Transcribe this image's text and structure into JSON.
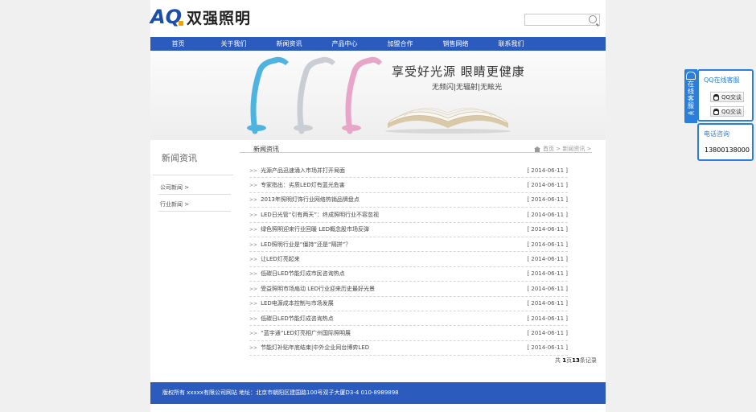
{
  "header": {
    "logo_mark_a": "A",
    "logo_mark_q": "Q",
    "logo_text": "双强照明",
    "search_placeholder": ""
  },
  "nav": [
    "首页",
    "关于我们",
    "新闻资讯",
    "产品中心",
    "加盟合作",
    "销售网络",
    "联系我们"
  ],
  "banner": {
    "title": "享受好光源 眼睛更健康",
    "subtitle": "无频闪|无辐射|无眩光"
  },
  "sidebar": {
    "title": "新闻资讯",
    "items": [
      "公司新闻  >",
      "行业新闻  >"
    ]
  },
  "content": {
    "title": "新闻资讯",
    "breadcrumb": "首页 > 新闻资讯 >",
    "news": [
      {
        "title": "光源产品迅速涌入市场并打开局面",
        "date": "[ 2014-06-11 ]"
      },
      {
        "title": "专家指出：劣质LED灯有蓝光危害",
        "date": "[ 2014-06-11 ]"
      },
      {
        "title": "2013年照明灯饰行业网络热销品牌盘点",
        "date": "[ 2014-06-11 ]"
      },
      {
        "title": "LED日光管“引有两天”：终成照明行业不容忽视",
        "date": "[ 2014-06-11 ]"
      },
      {
        "title": "绿色照明迎来行业回暖 LED概念股市场反弹",
        "date": "[ 2014-06-11 ]"
      },
      {
        "title": "LED照明行业是“僵持”还是“隔拼”？",
        "date": "[ 2014-06-11 ]"
      },
      {
        "title": "让LED灯亮起来",
        "date": "[ 2014-06-11 ]"
      },
      {
        "title": "低碳日LED节能灯成市民咨询热点",
        "date": "[ 2014-06-11 ]"
      },
      {
        "title": "受益照明市场扇动 LED行业迎来历史最好光景",
        "date": "[ 2014-06-11 ]"
      },
      {
        "title": "LED电源成本控制与市场发展",
        "date": "[ 2014-06-11 ]"
      },
      {
        "title": "低碳日LED节能灯成咨询热点",
        "date": "[ 2014-06-11 ]"
      },
      {
        "title": "“蓝宇通”LED灯亮相广州国际照明展",
        "date": "[ 2014-06-11 ]"
      },
      {
        "title": "节能灯补贴年底结束|中外企业同台博弈LED",
        "date": "[ 2014-06-11 ]"
      }
    ],
    "pager_prefix": "共 ",
    "pager_page": "1",
    "pager_mid": "页",
    "pager_count": "13",
    "pager_suffix": "条记录"
  },
  "footer": {
    "text": "版权所有 xxxxx有限公司网站  地址：北京市朝阳区建国路100号双子大厦D3-4 010-8989898"
  },
  "service": {
    "tab_label": [
      "在",
      "线",
      "客",
      "服",
      "≪"
    ],
    "qq_title": "QQ在线客服",
    "qq_buttons": [
      "QQ交谈",
      "QQ交谈"
    ],
    "phone_title": "电话咨询",
    "phone": "13800138000"
  },
  "colors": {
    "nav": "#2b5bbc",
    "service_accent": "#2b7ed9"
  }
}
